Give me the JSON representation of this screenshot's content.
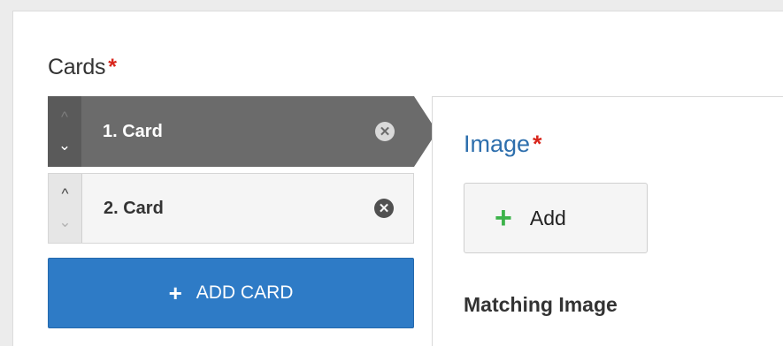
{
  "cards_section": {
    "label": "Cards",
    "required_mark": "*",
    "items": [
      {
        "label": "1. Card",
        "up": "^",
        "down": "⌄",
        "remove": "✕",
        "selected": true
      },
      {
        "label": "2. Card",
        "up": "^",
        "down": "⌄",
        "remove": "✕",
        "selected": false
      }
    ],
    "add_button": {
      "plus": "+",
      "label": "ADD CARD"
    }
  },
  "detail": {
    "image_label": "Image",
    "required_mark": "*",
    "add_button": {
      "plus": "+",
      "label": "Add"
    },
    "matching_label": "Matching Image"
  },
  "colors": {
    "selected_card": "#6b6b6b",
    "primary_button": "#2e7bc6",
    "required": "#d9261c",
    "image_label": "#2e6fad",
    "add_plus": "#3cb34a"
  }
}
